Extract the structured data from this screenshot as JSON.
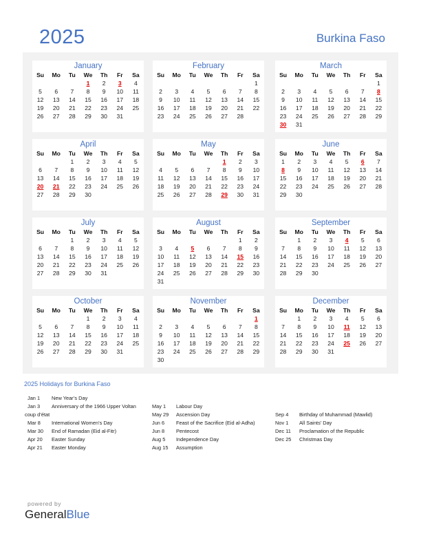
{
  "header": {
    "year": "2025",
    "country": "Burkina Faso"
  },
  "weekdays": [
    "Su",
    "Mo",
    "Tu",
    "We",
    "Th",
    "Fr",
    "Sa"
  ],
  "months": [
    {
      "name": "January",
      "start": 3,
      "days": 31,
      "holidays": [
        1,
        3
      ]
    },
    {
      "name": "February",
      "start": 6,
      "days": 28,
      "holidays": []
    },
    {
      "name": "March",
      "start": 6,
      "days": 31,
      "holidays": [
        8,
        30
      ]
    },
    {
      "name": "April",
      "start": 2,
      "days": 30,
      "holidays": [
        20,
        21
      ]
    },
    {
      "name": "May",
      "start": 4,
      "days": 31,
      "holidays": [
        1,
        29
      ]
    },
    {
      "name": "June",
      "start": 0,
      "days": 30,
      "holidays": [
        6,
        8
      ]
    },
    {
      "name": "July",
      "start": 2,
      "days": 31,
      "holidays": []
    },
    {
      "name": "August",
      "start": 5,
      "days": 31,
      "holidays": [
        5,
        15
      ]
    },
    {
      "name": "September",
      "start": 1,
      "days": 30,
      "holidays": [
        4
      ]
    },
    {
      "name": "October",
      "start": 3,
      "days": 31,
      "holidays": []
    },
    {
      "name": "November",
      "start": 6,
      "days": 30,
      "holidays": [
        1
      ]
    },
    {
      "name": "December",
      "start": 1,
      "days": 31,
      "holidays": [
        11,
        25
      ]
    }
  ],
  "holidays_section": {
    "title": "2025 Holidays for Burkina Faso",
    "columns": [
      [
        {
          "date": "Jan 1",
          "name": "New Year’s Day"
        },
        {
          "date": "Jan 3",
          "name": "Anniversary of the 1966 Upper Voltan"
        },
        {
          "date": "",
          "name": "coup d’état",
          "wrap": true
        },
        {
          "date": "Mar 8",
          "name": "International Women’s Day"
        },
        {
          "date": "Mar 30",
          "name": "End of Ramadan (Eid al-Fitr)"
        },
        {
          "date": "Apr 20",
          "name": "Easter Sunday"
        },
        {
          "date": "Apr 21",
          "name": "Easter Monday"
        }
      ],
      [
        {
          "date": "May 1",
          "name": "Labour Day"
        },
        {
          "date": "May 29",
          "name": "Ascension Day"
        },
        {
          "date": "Jun 6",
          "name": "Feast of the Sacrifice (Eid al-Adha)"
        },
        {
          "date": "Jun 8",
          "name": "Pentecost"
        },
        {
          "date": "Aug 5",
          "name": "Independence Day"
        },
        {
          "date": "Aug 15",
          "name": "Assumption"
        }
      ],
      [
        {
          "date": "Sep 4",
          "name": "Birthday of Muhammad (Mawlid)"
        },
        {
          "date": "Nov 1",
          "name": "All Saints’ Day"
        },
        {
          "date": "Dec 11",
          "name": "Proclamation of the Republic"
        },
        {
          "date": "Dec 25",
          "name": "Christmas Day"
        }
      ]
    ]
  },
  "footer": {
    "powered_by": "powered by",
    "brand_general": "General",
    "brand_blue": "Blue"
  },
  "colors": {
    "accent": "#4472c4",
    "holiday": "#e00000",
    "panel_bg": "#f2f2f2"
  }
}
